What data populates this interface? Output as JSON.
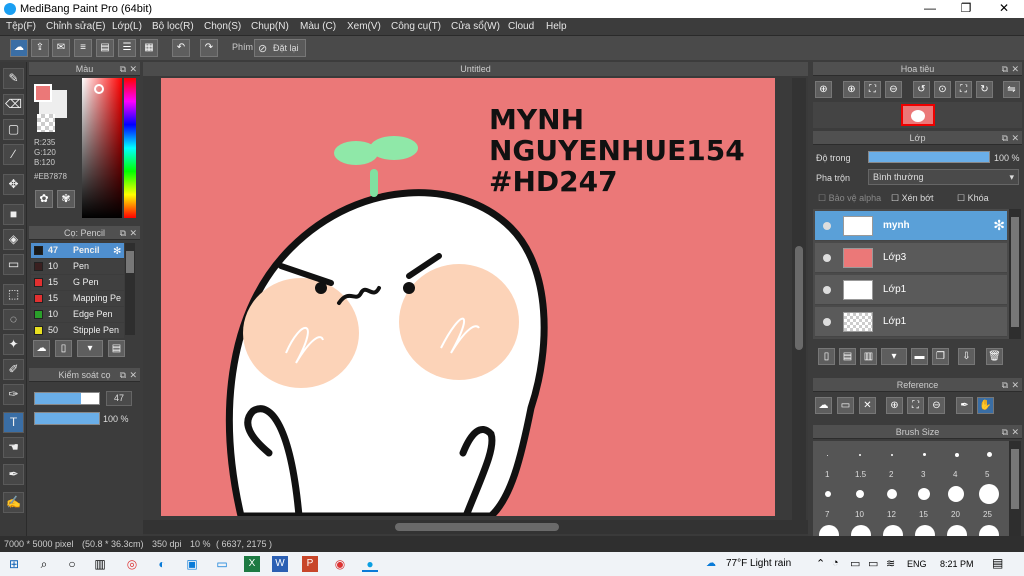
{
  "app": {
    "title": "MediBang Paint Pro (64bit)"
  },
  "menu": [
    "Tệp(F)",
    "Chỉnh sửa(E)",
    "Lớp(L)",
    "Bộ lọc(R)",
    "Chọn(S)",
    "Chụp(N)",
    "Màu (C)",
    "Xem(V)",
    "Công cụ(T)",
    "Cửa sổ(W)",
    "Cloud",
    "Help"
  ],
  "toolbar": {
    "shortcut_label": "Phím",
    "reset_label": "Đặt lại"
  },
  "color_panel": {
    "title": "Màu",
    "r": "R:235",
    "g": "G:120",
    "b": "B:120",
    "hex": "#EB7878",
    "primary_color": "#eb7878"
  },
  "brush_panel": {
    "title": "Cọ: Pencil",
    "items": [
      {
        "size": "47",
        "name": "Pencil",
        "color": "#1a1a1a"
      },
      {
        "size": "10",
        "name": "Pen",
        "color": "#3a2020"
      },
      {
        "size": "15",
        "name": "G Pen",
        "color": "#e23030"
      },
      {
        "size": "15",
        "name": "Mapping Pe",
        "color": "#e23030"
      },
      {
        "size": "10",
        "name": "Edge Pen",
        "color": "#2aa02a"
      },
      {
        "size": "50",
        "name": "Stipple Pen",
        "color": "#e8e020"
      }
    ]
  },
  "brush_control": {
    "title": "Kiểm soát cọ",
    "size": "47",
    "opacity": "100 %",
    "opacity_level": 1.0
  },
  "canvas": {
    "doc_title": "Untitled",
    "text_lines": [
      "MYNH",
      "NGUYENHUE154",
      "#HD247"
    ]
  },
  "navigator": {
    "title": "Hoa tiêu"
  },
  "layers": {
    "title": "Lớp",
    "opacity_label": "Độ trong",
    "opacity_value": "100 %",
    "opacity_level": 1.0,
    "blend_label": "Pha trộn",
    "blend_value": "Bình thường",
    "protect_alpha": "Bảo vệ alpha",
    "clipping": "Xén bớt",
    "lock": "Khóa",
    "items": [
      "mynh",
      "Lớp3",
      "Lớp1",
      "Lớp1"
    ]
  },
  "reference": {
    "title": "Reference"
  },
  "brush_size": {
    "title": "Brush Size",
    "row1": [
      "1",
      "1.5",
      "2",
      "3",
      "4",
      "5"
    ],
    "row2": [
      "7",
      "10",
      "12",
      "15",
      "20",
      "25"
    ]
  },
  "status": {
    "size": "7000 * 5000 pixel",
    "cm": "(50.8 * 36.3cm)",
    "dpi": "350 dpi",
    "zoom": "10 %",
    "coords": "( 6637, 2175 )"
  },
  "taskbar": {
    "weather": "77°F  Light rain",
    "lang": "ENG",
    "time": "8:21 PM"
  }
}
